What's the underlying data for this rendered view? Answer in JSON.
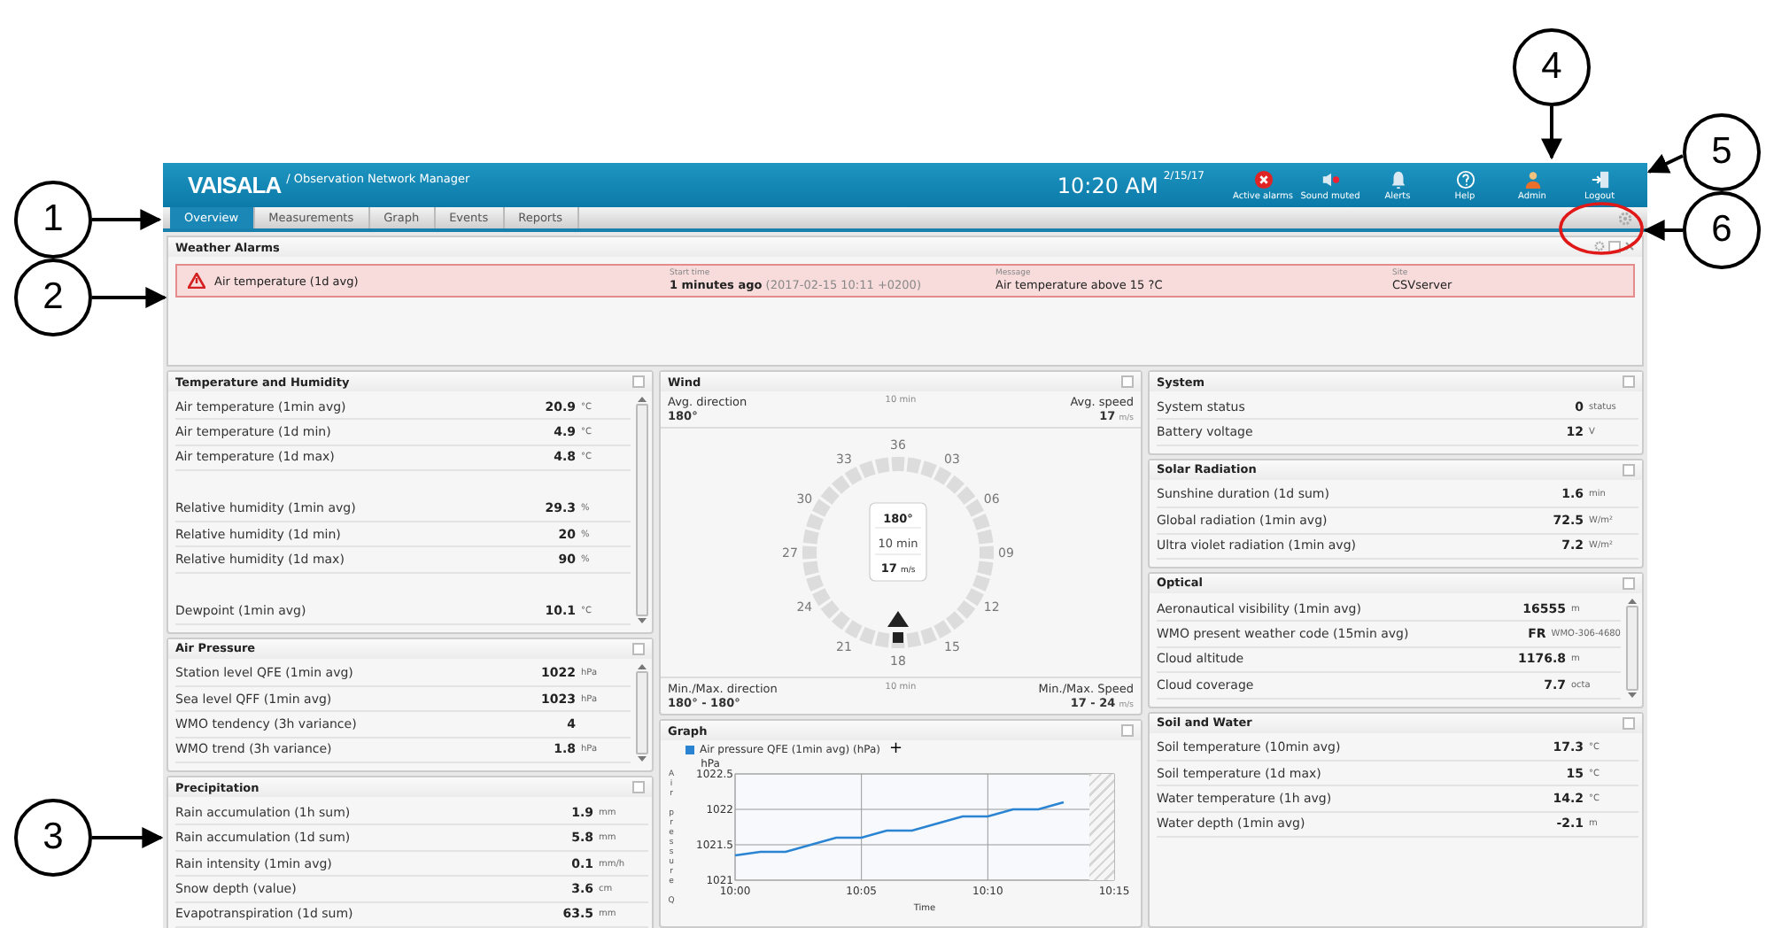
{
  "header": {
    "logo": "VAISALA",
    "app_title": "/ Observation Network Manager",
    "time": "10:20 AM",
    "date": "2/15/17",
    "actions": [
      {
        "kind": "alarm",
        "label": "Active alarms"
      },
      {
        "kind": "muted",
        "label": "Sound muted"
      },
      {
        "kind": "bell",
        "label": "Alerts"
      },
      {
        "kind": "help",
        "label": "Help"
      },
      {
        "kind": "admin",
        "label": "Admin"
      },
      {
        "kind": "logout",
        "label": "Logout"
      }
    ]
  },
  "tabs": [
    {
      "label": "Overview",
      "selected": true
    },
    {
      "label": "Measurements",
      "selected": false
    },
    {
      "label": "Graph",
      "selected": false
    },
    {
      "label": "Events",
      "selected": false
    },
    {
      "label": "Reports",
      "selected": false
    }
  ],
  "alarms": {
    "title": "Weather Alarms",
    "items": [
      {
        "name": "Air temperature (1d avg)",
        "start_label": "Start time",
        "time_ago": "1 minutes ago",
        "time_detail": "(2017-02-15 10:11 +0200)",
        "message_label": "Message",
        "message": "Air temperature above 15 ?C",
        "site_label": "Site",
        "site": "CSVserver"
      }
    ]
  },
  "columns": [
    {
      "panels": [
        {
          "kind": "list",
          "title": "Temperature and Humidity",
          "scrollable": true,
          "rows": [
            {
              "kind": "row",
              "label": "Air temperature (1min avg)",
              "value": "20.9",
              "unit": "°C"
            },
            {
              "kind": "row",
              "label": "Air temperature (1d min)",
              "value": "4.9",
              "unit": "°C"
            },
            {
              "kind": "row",
              "label": "Air temperature (1d max)",
              "value": "4.8",
              "unit": "°C"
            },
            {
              "kind": "gap"
            },
            {
              "kind": "row",
              "label": "Relative humidity (1min avg)",
              "value": "29.3",
              "unit": "%"
            },
            {
              "kind": "row",
              "label": "Relative humidity (1d min)",
              "value": "20",
              "unit": "%"
            },
            {
              "kind": "row",
              "label": "Relative humidity (1d max)",
              "value": "90",
              "unit": "%"
            },
            {
              "kind": "gap"
            },
            {
              "kind": "row",
              "label": "Dewpoint (1min avg)",
              "value": "10.1",
              "unit": "°C"
            }
          ]
        },
        {
          "kind": "list",
          "title": "Air Pressure",
          "scrollable": true,
          "rows": [
            {
              "kind": "row",
              "label": "Station level QFE (1min avg)",
              "value": "1022",
              "unit": "hPa"
            },
            {
              "kind": "row",
              "label": "Sea level QFF (1min avg)",
              "value": "1023",
              "unit": "hPa"
            },
            {
              "kind": "row",
              "label": "WMO tendency (3h variance)",
              "value": "4"
            },
            {
              "kind": "row",
              "label": "WMO trend (3h variance)",
              "value": "1.8",
              "unit": "hPa"
            }
          ]
        },
        {
          "kind": "list",
          "title": "Precipitation",
          "scrollable": false,
          "rows": [
            {
              "kind": "row",
              "label": "Rain accumulation (1h sum)",
              "value": "1.9",
              "unit": "mm"
            },
            {
              "kind": "row",
              "label": "Rain accumulation (1d sum)",
              "value": "5.8",
              "unit": "mm"
            },
            {
              "kind": "row",
              "label": "Rain intensity (1min avg)",
              "value": "0.1",
              "unit": "mm/h"
            },
            {
              "kind": "row",
              "label": "Snow depth (value)",
              "value": "3.6",
              "unit": "cm"
            },
            {
              "kind": "row",
              "label": "Evapotranspiration (1d sum)",
              "value": "63.5",
              "unit": "mm"
            }
          ]
        }
      ]
    },
    {
      "panels": [
        {
          "kind": "wind",
          "title": "Wind",
          "avg_direction_label": "Avg. direction",
          "avg_direction": "180°",
          "period": "10 min",
          "avg_speed_label": "Avg. speed",
          "avg_speed": "17",
          "speed_unit": "m/s",
          "compass_labels": [
            "36",
            "03",
            "06",
            "09",
            "12",
            "15",
            "18",
            "21",
            "24",
            "27",
            "30",
            "33"
          ],
          "center_direction": "180°",
          "center_period": "10 min",
          "center_speed": "17",
          "center_unit": "m/s",
          "minmax_direction_label": "Min./Max. direction",
          "minmax_period": "10 min",
          "minmax_direction": "180° - 180°",
          "minmax_speed_label": "Min./Max. Speed",
          "minmax_speed": "17 - 24",
          "minmax_unit": "m/s"
        },
        {
          "kind": "graph",
          "title": "Graph",
          "add_label": "+",
          "unit": "hPa",
          "chart_data": {
            "type": "line",
            "xlabel": "Time",
            "ylabel": "Air pressure Q",
            "categories": [
              "10:00",
              null,
              null,
              null,
              null,
              "10:05",
              null,
              null,
              null,
              null,
              "10:10",
              null,
              null,
              null,
              null,
              "10:15"
            ],
            "series": [
              {
                "name": "Air pressure QFE (1min avg) (hPa)",
                "color": "#2a84d2",
                "values": [
                  1021.35,
                  1021.4,
                  1021.4,
                  1021.5,
                  1021.6,
                  1021.6,
                  1021.7,
                  1021.7,
                  1021.8,
                  1021.9,
                  1021.9,
                  1022.0,
                  1022.0,
                  1022.1,
                  null,
                  null
                ]
              }
            ],
            "ylim": [
              1021,
              1022.5
            ],
            "grid": true,
            "yticks": [
              1021,
              {
                "value": 1021.5,
                "label": "1021.5"
              },
              1022,
              {
                "value": 1022.5,
                "label": "1022.5"
              }
            ]
          }
        }
      ]
    },
    {
      "panels": [
        {
          "kind": "list",
          "title": "System",
          "scrollable": false,
          "rows": [
            {
              "kind": "row",
              "label": "System status",
              "value": "0",
              "unit": "status"
            },
            {
              "kind": "row",
              "label": "Battery voltage",
              "value": "12",
              "unit": "V"
            }
          ]
        },
        {
          "kind": "list",
          "title": "Solar Radiation",
          "scrollable": false,
          "rows": [
            {
              "kind": "row",
              "label": "Sunshine duration (1d sum)",
              "value": "1.6",
              "unit": "min"
            },
            {
              "kind": "row",
              "label": "Global radiation (1min avg)",
              "value": "72.5",
              "unit": "W/m²"
            },
            {
              "kind": "row",
              "label": "Ultra violet radiation (1min avg)",
              "value": "7.2",
              "unit": "W/m²"
            }
          ]
        },
        {
          "kind": "list",
          "title": "Optical",
          "scrollable": true,
          "rows": [
            {
              "kind": "row",
              "label": "Aeronautical visibility (1min avg)",
              "value": "16555",
              "unit": "m"
            },
            {
              "kind": "row",
              "label": "WMO present weather code (15min avg)",
              "value": "FR",
              "unit": "WMO-306-4680"
            },
            {
              "kind": "row",
              "label": "Cloud altitude",
              "value": "1176.8",
              "unit": "m"
            },
            {
              "kind": "row",
              "label": "Cloud coverage",
              "value": "7.7",
              "unit": "octa"
            }
          ]
        },
        {
          "kind": "list",
          "title": "Soil and Water",
          "scrollable": false,
          "rows": [
            {
              "kind": "row",
              "label": "Soil temperature (10min avg)",
              "value": "17.3",
              "unit": "°C"
            },
            {
              "kind": "row",
              "label": "Soil temperature (1d max)",
              "value": "15",
              "unit": "°C"
            },
            {
              "kind": "row",
              "label": "Water temperature (1h avg)",
              "value": "14.2",
              "unit": "°C"
            },
            {
              "kind": "row",
              "label": "Water depth (1min avg)",
              "value": "-2.1",
              "unit": "m"
            }
          ]
        }
      ]
    }
  ],
  "callouts": [
    {
      "number": "1"
    },
    {
      "number": "2"
    },
    {
      "number": "3"
    },
    {
      "number": "4"
    },
    {
      "number": "5"
    },
    {
      "number": "6"
    }
  ]
}
